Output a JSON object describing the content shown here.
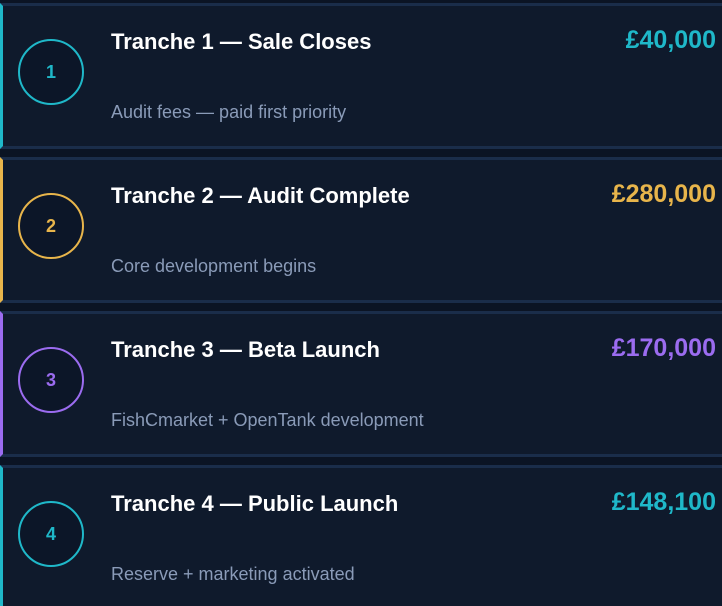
{
  "tranches": [
    {
      "number": "1",
      "title": "Tranche 1 — Sale Closes",
      "amount": "£40,000",
      "description": "Audit fees — paid first priority",
      "accent": "#1fb8c9"
    },
    {
      "number": "2",
      "title": "Tranche 2 — Audit Complete",
      "amount": "£280,000",
      "description": "Core development begins",
      "accent": "#e8b54b"
    },
    {
      "number": "3",
      "title": "Tranche 3 — Beta Launch",
      "amount": "£170,000",
      "description": "FishCmarket + OpenTank development",
      "accent": "#9b6cf0"
    },
    {
      "number": "4",
      "title": "Tranche 4 — Public Launch",
      "amount": "£148,100",
      "description": "Reserve + marketing activated",
      "accent": "#1fb8c9"
    }
  ]
}
